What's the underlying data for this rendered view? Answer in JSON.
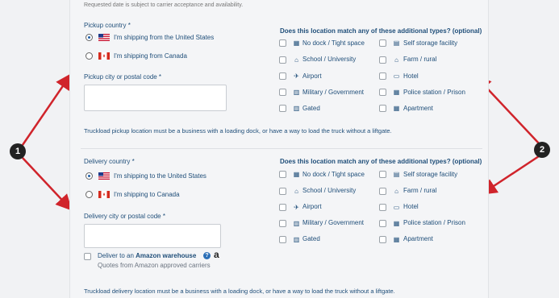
{
  "notice": "Requested date is subject to carrier acceptance and availability.",
  "types_label": "Does this location match any of these additional types? (optional)",
  "pickup": {
    "country_label": "Pickup country *",
    "option_us": "I'm shipping from the United States",
    "option_ca": "I'm shipping from Canada",
    "city_label": "Pickup city or postal code *",
    "city_value": "",
    "warning": "Truckload pickup location must be a business with a loading dock, or have a way to load the truck without a liftgate."
  },
  "delivery": {
    "country_label": "Delivery country *",
    "option_us": "I'm shipping to the United States",
    "option_ca": "I'm shipping to Canada",
    "city_label": "Delivery city or postal code *",
    "city_value": "",
    "amazon_prefix": "Deliver to an",
    "amazon_link": "Amazon warehouse",
    "amazon_sub": "Quotes from Amazon approved carriers",
    "warning": "Truckload delivery location must be a business with a loading dock, or have a way to load the truck without a liftgate."
  },
  "location_types": [
    {
      "label": "No dock / Tight space",
      "icon": "building-icon"
    },
    {
      "label": "Self storage facility",
      "icon": "storage-icon"
    },
    {
      "label": "School / University",
      "icon": "graduation-cap-icon"
    },
    {
      "label": "Farm / rural",
      "icon": "farm-icon"
    },
    {
      "label": "Airport",
      "icon": "airplane-icon"
    },
    {
      "label": "Hotel",
      "icon": "bed-icon"
    },
    {
      "label": "Military / Government",
      "icon": "government-icon"
    },
    {
      "label": "Police station / Prison",
      "icon": "police-icon"
    },
    {
      "label": "Gated",
      "icon": "gate-icon"
    },
    {
      "label": "Apartment",
      "icon": "apartment-icon"
    }
  ],
  "callouts": [
    "1",
    "2"
  ],
  "colors": {
    "text": "#1f4e79",
    "arrow": "#d0242b",
    "accent": "#2c6fb7"
  }
}
